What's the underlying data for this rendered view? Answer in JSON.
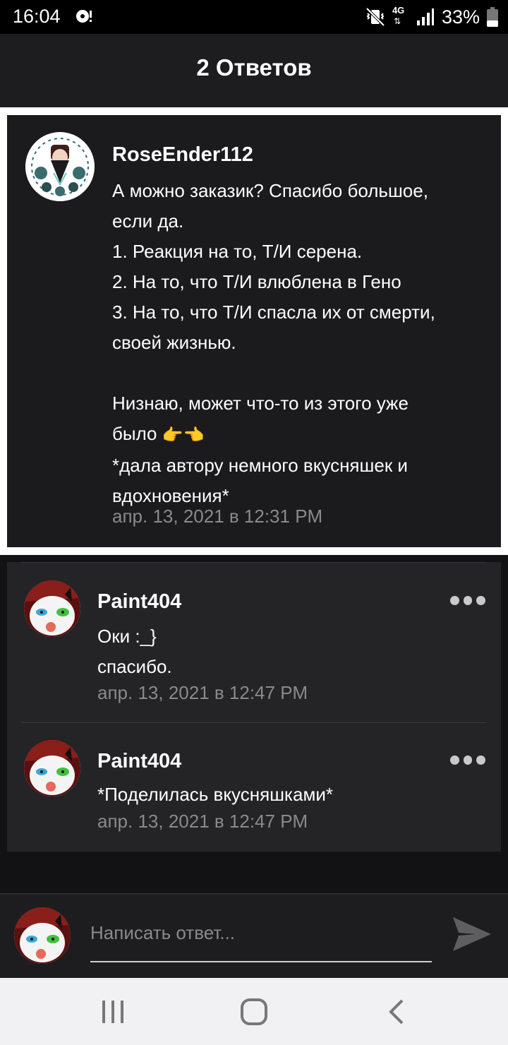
{
  "status_bar": {
    "time": "16:04",
    "network": "4G",
    "battery": "33%"
  },
  "header": {
    "title": "2 Ответов"
  },
  "main_comment": {
    "author": "RoseEnder112",
    "lines": [
      "А можно заказик? Спасибо большое,",
      "если да.",
      "1. Реакция на то, Т/И серена.",
      "2. На то, что Т/И влюблена в Гено",
      "3. На то, что Т/И спасла их от смерти,",
      "своей жизнью.",
      "",
      "Низнаю, может что-то из этого уже",
      "было",
      "*дала автору немного вкусняшек и",
      "вдохновения*"
    ],
    "emoji": "👉👈",
    "timestamp": "апр. 13, 2021 в 12:31 PM"
  },
  "replies": [
    {
      "author": "Paint404",
      "lines": [
        "Оки :_}",
        "спасибо."
      ],
      "timestamp": "апр. 13, 2021 в 12:47 PM"
    },
    {
      "author": "Paint404",
      "lines": [
        "*Поделилась вкусняшками*"
      ],
      "timestamp": "апр. 13, 2021 в 12:47 PM"
    }
  ],
  "composer": {
    "placeholder": "Написать ответ..."
  },
  "colors": {
    "background": "#121113",
    "card": "#1b1a1c",
    "reply_card": "#242326",
    "muted_text": "#8a898c"
  }
}
